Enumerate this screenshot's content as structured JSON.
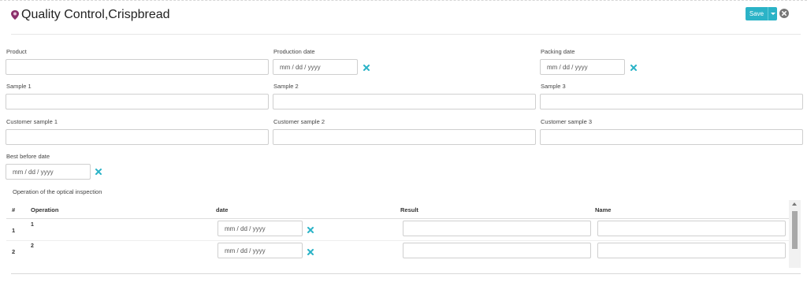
{
  "header": {
    "title": "Quality Control,Crispbread",
    "icon": "pin-icon"
  },
  "toolbar": {
    "save_label": "Save",
    "accent": "#2bb3c7"
  },
  "form": {
    "product_label": "Product",
    "production_date_label": "Production date",
    "production_date_placeholder": "mm / dd / yyyy",
    "packing_date_label": "Packing date",
    "packing_date_placeholder": "mm / dd / yyyy",
    "sample1_label": "Sample 1",
    "sample2_label": "Sample 2",
    "sample3_label": "Sample 3",
    "customer_sample1_label": "Customer sample 1",
    "customer_sample2_label": "Customer sample 2",
    "customer_sample3_label": "Customer sample 3",
    "best_before_label": "Best before date",
    "best_before_placeholder": "mm / dd / yyyy"
  },
  "inspection": {
    "title": "Operation of the optical inspection",
    "columns": [
      "#",
      "Operation",
      "date",
      "Result",
      "Name"
    ],
    "rows": [
      {
        "num": "1",
        "operation": "1",
        "date_placeholder": "mm / dd / yyyy"
      },
      {
        "num": "2",
        "operation": "2",
        "date_placeholder": "mm / dd / yyyy"
      }
    ]
  },
  "colors": {
    "clear_icon": "#2bb3c7",
    "pin": "#8b2f6b"
  }
}
